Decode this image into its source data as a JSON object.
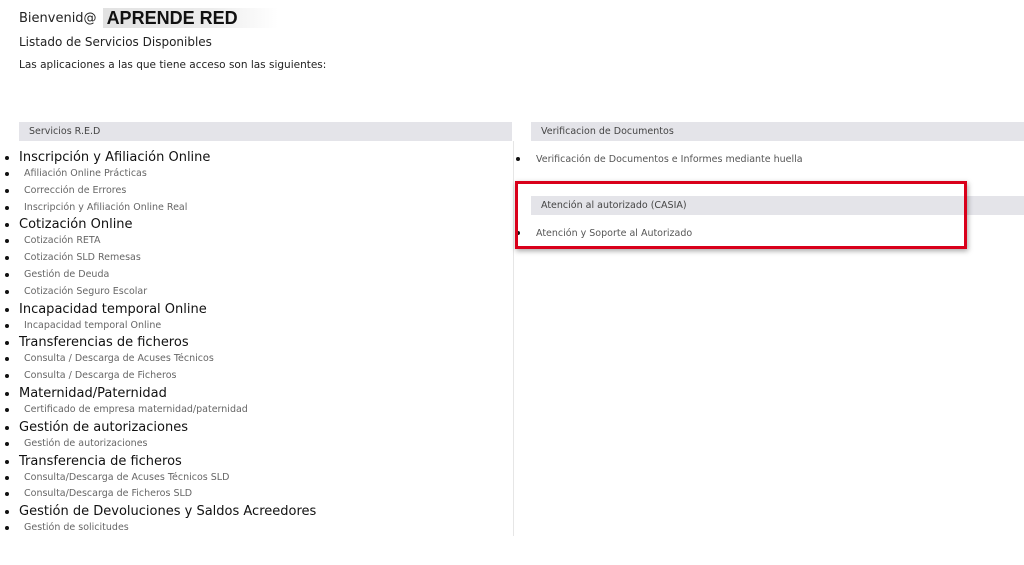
{
  "header": {
    "welcome_label": "Bienvenid@",
    "user_name": "APRENDE RED",
    "subtitle": "Listado de Servicios Disponibles",
    "intro": "Las aplicaciones a las que tiene acceso son las siguientes:"
  },
  "sections": {
    "servicios_red": {
      "title": "Servicios R.E.D",
      "groups": [
        {
          "label": "Inscripción y Afiliación Online",
          "items": [
            "Afiliación Online Prácticas",
            "Corrección de Errores",
            "Inscripción y Afiliación Online Real"
          ]
        },
        {
          "label": "Cotización Online",
          "items": [
            "Cotización RETA",
            "Cotización SLD Remesas",
            "Gestión de Deuda",
            "Cotización Seguro Escolar"
          ]
        },
        {
          "label": "Incapacidad temporal Online",
          "items": [
            "Incapacidad temporal Online"
          ]
        },
        {
          "label": "Transferencias de ficheros",
          "items": [
            "Consulta / Descarga de Acuses Técnicos",
            "Consulta / Descarga de Ficheros"
          ]
        },
        {
          "label": "Maternidad/Paternidad",
          "items": [
            "Certificado de empresa maternidad/paternidad"
          ]
        },
        {
          "label": "Gestión de autorizaciones",
          "items": [
            "Gestión de autorizaciones"
          ]
        },
        {
          "label": "Transferencia de ficheros",
          "items": [
            "Consulta/Descarga de Acuses Técnicos SLD",
            "Consulta/Descarga de Ficheros SLD"
          ]
        },
        {
          "label": "Gestión de Devoluciones y Saldos Acreedores",
          "items": [
            "Gestión de solicitudes"
          ]
        }
      ]
    },
    "verificacion": {
      "title": "Verificacion de Documentos",
      "items": [
        "Verificación de Documentos e Informes mediante huella"
      ]
    },
    "casia": {
      "title": "Atención al autorizado (CASIA)",
      "items": [
        "Atención y Soporte al Autorizado"
      ]
    }
  },
  "colors": {
    "highlight": "#d9001b",
    "section_header_bg": "#e4e4e9"
  }
}
